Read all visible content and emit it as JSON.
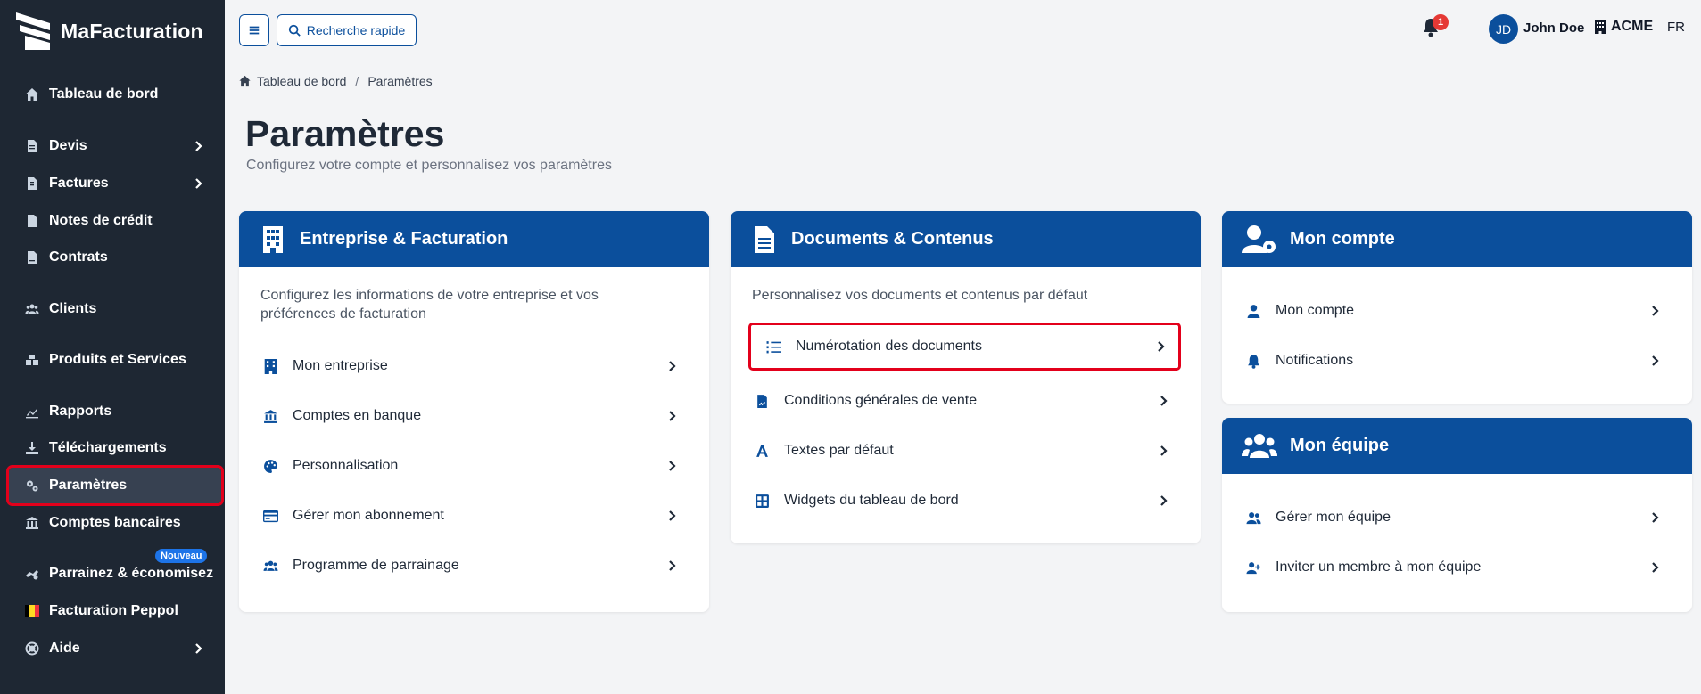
{
  "app": {
    "name": "MaFacturation"
  },
  "sidebar": {
    "items": [
      {
        "label": "Tableau de bord",
        "icon": "home-icon"
      },
      {
        "label": "Devis",
        "icon": "document-icon",
        "has_children": true
      },
      {
        "label": "Factures",
        "icon": "invoice-icon",
        "has_children": true
      },
      {
        "label": "Notes de crédit",
        "icon": "credit-note-icon"
      },
      {
        "label": "Contrats",
        "icon": "contract-icon"
      },
      {
        "label": "Clients",
        "icon": "users-icon"
      },
      {
        "label": "Produits et Services",
        "icon": "boxes-icon"
      },
      {
        "label": "Rapports",
        "icon": "chart-icon"
      },
      {
        "label": "Téléchargements",
        "icon": "download-icon"
      },
      {
        "label": "Paramètres",
        "icon": "gears-icon",
        "active": true
      },
      {
        "label": "Comptes bancaires",
        "icon": "bank-icon"
      },
      {
        "label": "Parrainez & économisez",
        "icon": "handshake-icon",
        "badge": "Nouveau"
      },
      {
        "label": "Facturation Peppol",
        "icon": "belgium-flag-icon"
      },
      {
        "label": "Aide",
        "icon": "help-icon",
        "has_children": true
      }
    ]
  },
  "topbar": {
    "search_label": "Recherche rapide",
    "notifications_count": "1",
    "user_initials": "JD",
    "user_name": "John Doe",
    "company": "ACME",
    "language": "FR"
  },
  "breadcrumb": {
    "home": "Tableau de bord",
    "current": "Paramètres"
  },
  "page": {
    "title": "Paramètres",
    "subtitle": "Configurez votre compte et personnalisez vos paramètres"
  },
  "cards": {
    "entreprise": {
      "title": "Entreprise & Facturation",
      "description": "Configurez les informations de votre entreprise et vos préférences de facturation",
      "items": [
        "Mon entreprise",
        "Comptes en banque",
        "Personnalisation",
        "Gérer mon abonnement",
        "Programme de parrainage"
      ]
    },
    "documents": {
      "title": "Documents & Contenus",
      "description": "Personnalisez vos documents et contenus par défaut",
      "items": [
        "Numérotation des documents",
        "Conditions générales de vente",
        "Textes par défaut",
        "Widgets du tableau de bord"
      ]
    },
    "compte": {
      "title": "Mon compte",
      "items": [
        "Mon compte",
        "Notifications"
      ]
    },
    "equipe": {
      "title": "Mon équipe",
      "items": [
        "Gérer mon équipe",
        "Inviter un membre à mon équipe"
      ]
    }
  },
  "colors": {
    "primary": "#0b4f9c",
    "sidebar": "#1e2733",
    "highlight": "#e3001b",
    "badge": "#1d74e8"
  }
}
